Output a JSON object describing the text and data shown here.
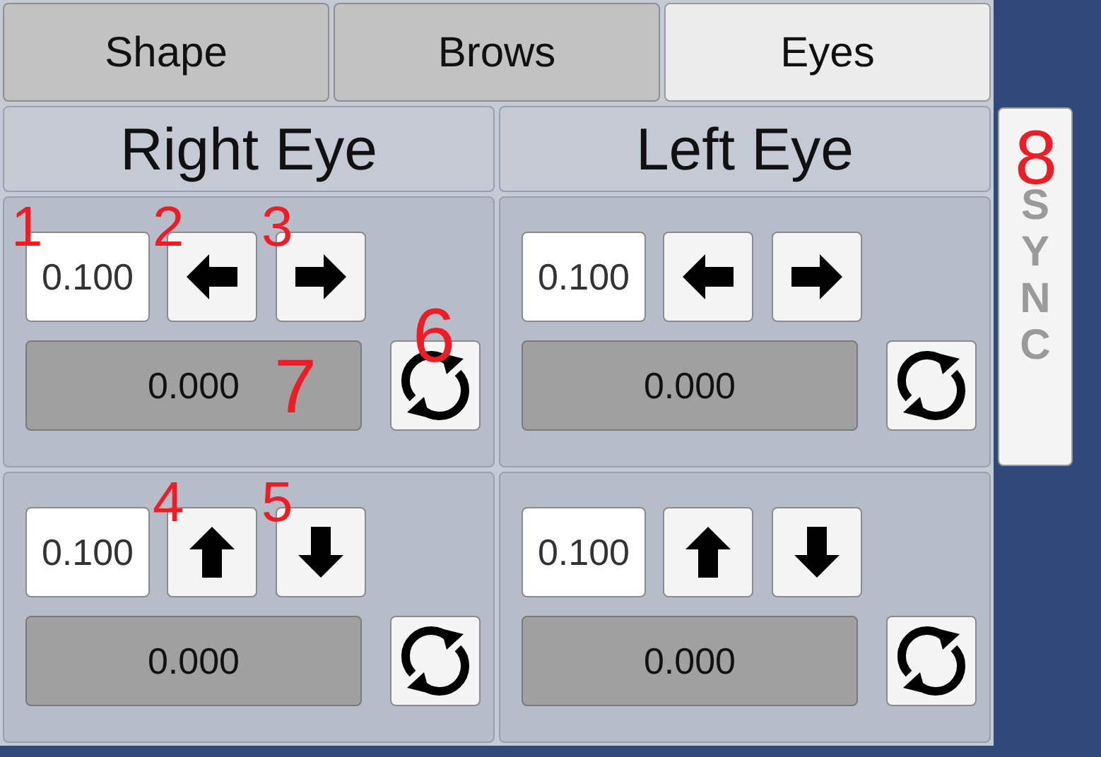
{
  "tabs": [
    {
      "label": "Shape",
      "selected": false
    },
    {
      "label": "Brows",
      "selected": false
    },
    {
      "label": "Eyes",
      "selected": true
    }
  ],
  "columns": [
    {
      "title": "Right Eye",
      "panels": [
        {
          "kind": "horizontal",
          "step": "0.100",
          "value": "0.000",
          "markers": {
            "step": "1",
            "decrease": "2",
            "increase": "3",
            "reset": "6",
            "value": "7"
          }
        },
        {
          "kind": "vertical",
          "step": "0.100",
          "value": "0.000",
          "markers": {
            "decrease": "4",
            "increase": "5"
          }
        }
      ]
    },
    {
      "title": "Left Eye",
      "panels": [
        {
          "kind": "horizontal",
          "step": "0.100",
          "value": "0.000"
        },
        {
          "kind": "vertical",
          "step": "0.100",
          "value": "0.000"
        }
      ]
    }
  ],
  "sync": {
    "label": "SYNC",
    "marker": "8"
  }
}
